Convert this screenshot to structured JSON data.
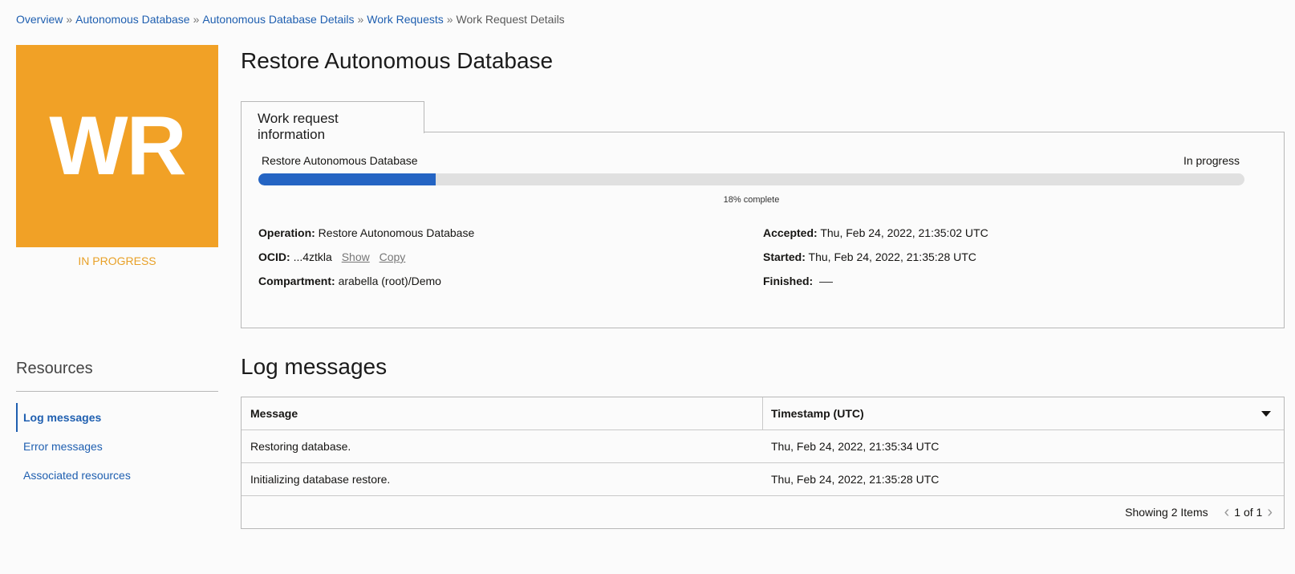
{
  "breadcrumb": {
    "items": [
      "Overview",
      "Autonomous Database",
      "Autonomous Database Details",
      "Work Requests"
    ],
    "current": "Work Request Details",
    "separator": "»"
  },
  "tile": {
    "initials": "WR",
    "status": "IN PROGRESS",
    "color": "#f1a126"
  },
  "page_title": "Restore Autonomous Database",
  "tab_label": "Work request information",
  "progress": {
    "label": "Restore Autonomous Database",
    "state": "In progress",
    "percent": 18,
    "percent_text": "18% complete",
    "color": "#2464c3"
  },
  "info": {
    "operation_label": "Operation:",
    "operation_value": "Restore Autonomous Database",
    "ocid_label": "OCID:",
    "ocid_value": "...4ztkla",
    "show_label": "Show",
    "copy_label": "Copy",
    "compartment_label": "Compartment:",
    "compartment_value": "arabella (root)/Demo",
    "accepted_label": "Accepted:",
    "accepted_value": "Thu, Feb 24, 2022, 21:35:02 UTC",
    "started_label": "Started:",
    "started_value": "Thu, Feb 24, 2022, 21:35:28 UTC",
    "finished_label": "Finished:"
  },
  "resources": {
    "title": "Resources",
    "items": [
      "Log messages",
      "Error messages",
      "Associated resources"
    ],
    "active_index": 0
  },
  "log": {
    "title": "Log messages",
    "columns": [
      "Message",
      "Timestamp (UTC)"
    ],
    "rows": [
      {
        "message": "Restoring database.",
        "timestamp": "Thu, Feb 24, 2022, 21:35:34 UTC"
      },
      {
        "message": "Initializing database restore.",
        "timestamp": "Thu, Feb 24, 2022, 21:35:28 UTC"
      }
    ],
    "showing": "Showing 2 Items",
    "page": "1 of 1"
  }
}
